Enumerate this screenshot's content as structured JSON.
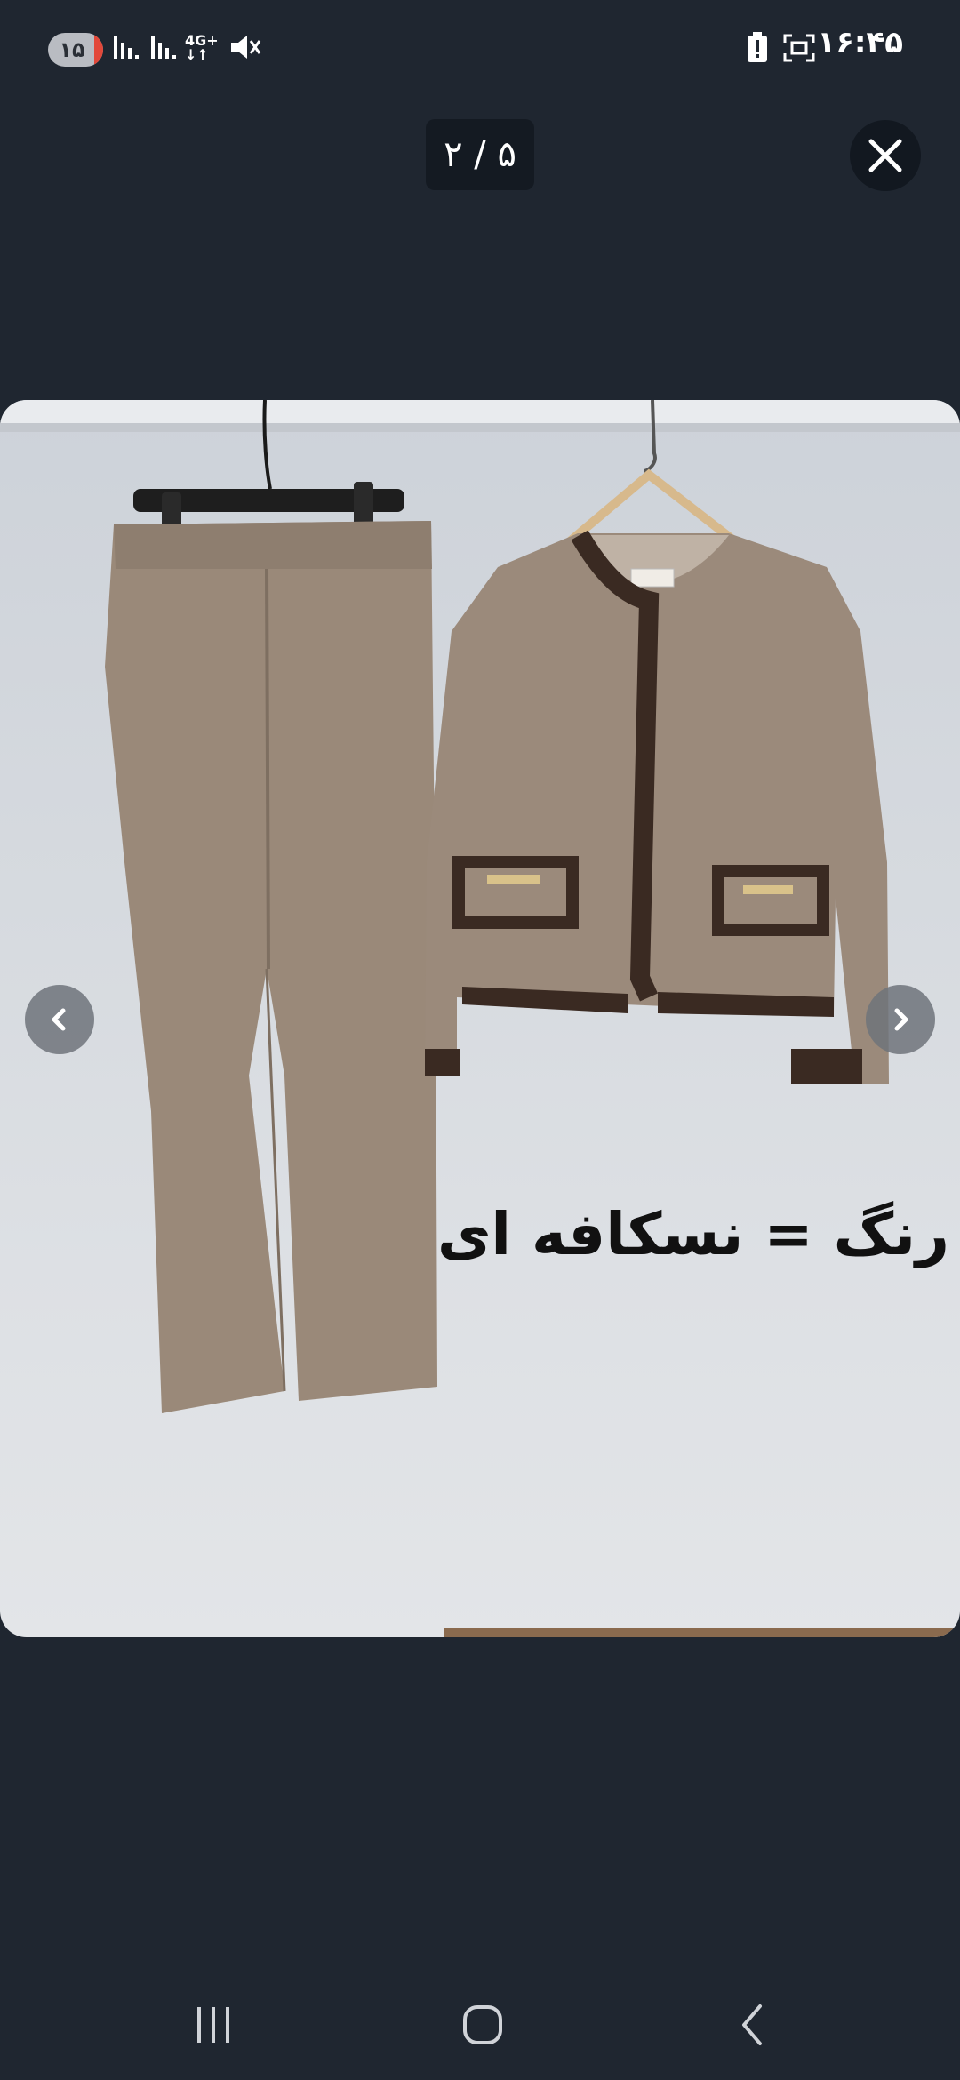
{
  "status_bar": {
    "badge": "۱۵",
    "network": "4G+",
    "time": "۱۶:۴۵",
    "icons": [
      "signal-bars-icon",
      "signal-bars-icon",
      "network-4g-icon",
      "mute-icon",
      "battery-alert-icon",
      "screenshot-icon"
    ]
  },
  "viewer": {
    "counter": "۲ / ۵",
    "close_icon": "close-icon",
    "prev_icon": "chevron-left-icon",
    "next_icon": "chevron-right-icon"
  },
  "photo": {
    "caption": "رنگ = نسکافه ای"
  },
  "nav_bar": {
    "icons": [
      "recent-apps-icon",
      "home-icon",
      "back-icon"
    ]
  },
  "colors": {
    "background": "#1f2630",
    "fabric": "#9b8a7b",
    "trim": "#3a2a22",
    "wall": "#d6dadf"
  }
}
